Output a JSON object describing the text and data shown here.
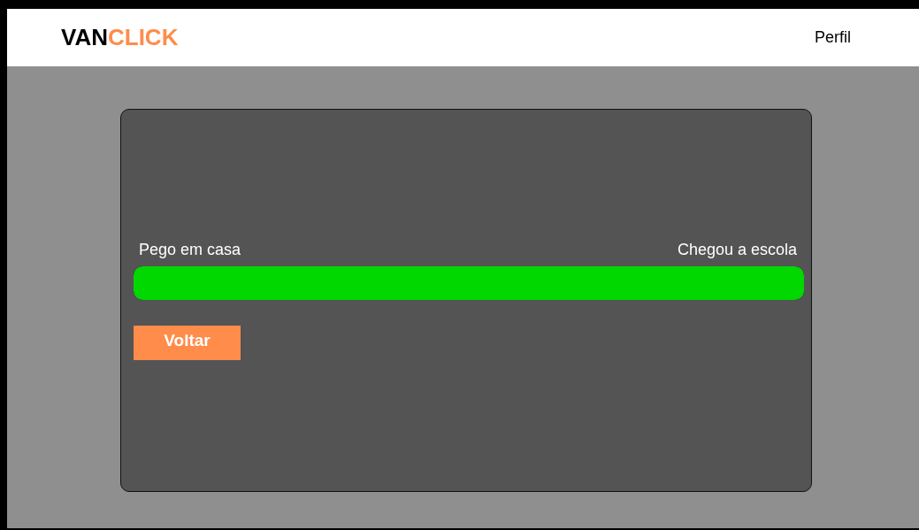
{
  "header": {
    "logo": {
      "first": "VAN",
      "second": "CLICK"
    },
    "profile_link": "Perfil"
  },
  "tracker": {
    "start_label": "Pego em casa",
    "end_label": "Chegou a escola",
    "level": 1
  },
  "buttons": [
    "Voltar"
  ]
}
